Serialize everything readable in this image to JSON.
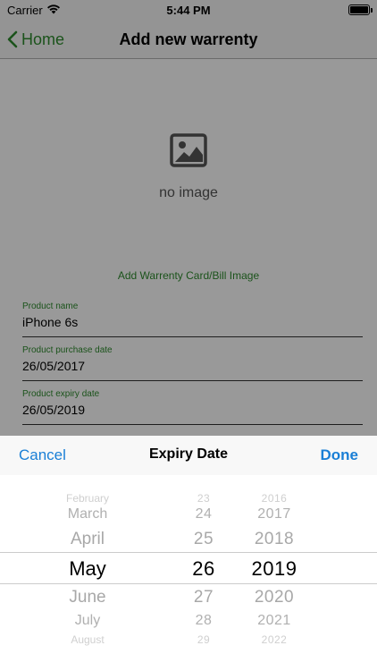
{
  "status_bar": {
    "carrier": "Carrier",
    "time": "5:44 PM",
    "wifi_icon": "wifi-icon",
    "battery_icon": "battery-icon"
  },
  "nav": {
    "back_label": "Home",
    "back_icon": "chevron-left-icon",
    "title": "Add new warrenty",
    "accent_color": "#2e8b2e"
  },
  "image_area": {
    "placeholder_icon": "image-placeholder-icon",
    "placeholder_text": "no image",
    "add_link": "Add Warrenty Card/Bill Image"
  },
  "fields": [
    {
      "label": "Product name",
      "value": "iPhone 6s"
    },
    {
      "label": "Product purchase date",
      "value": "26/05/2017"
    },
    {
      "label": "Product expiry date",
      "value": "26/05/2019"
    }
  ],
  "picker": {
    "cancel_label": "Cancel",
    "title": "Expiry Date",
    "done_label": "Done",
    "button_color": "#1a7fd6",
    "months": [
      "February",
      "March",
      "April",
      "May",
      "June",
      "July",
      "August"
    ],
    "days": [
      "23",
      "24",
      "25",
      "26",
      "27",
      "28",
      "29"
    ],
    "years": [
      "2016",
      "2017",
      "2018",
      "2019",
      "2020",
      "2021",
      "2022"
    ],
    "selected": {
      "month": "May",
      "day": "26",
      "year": "2019"
    }
  }
}
